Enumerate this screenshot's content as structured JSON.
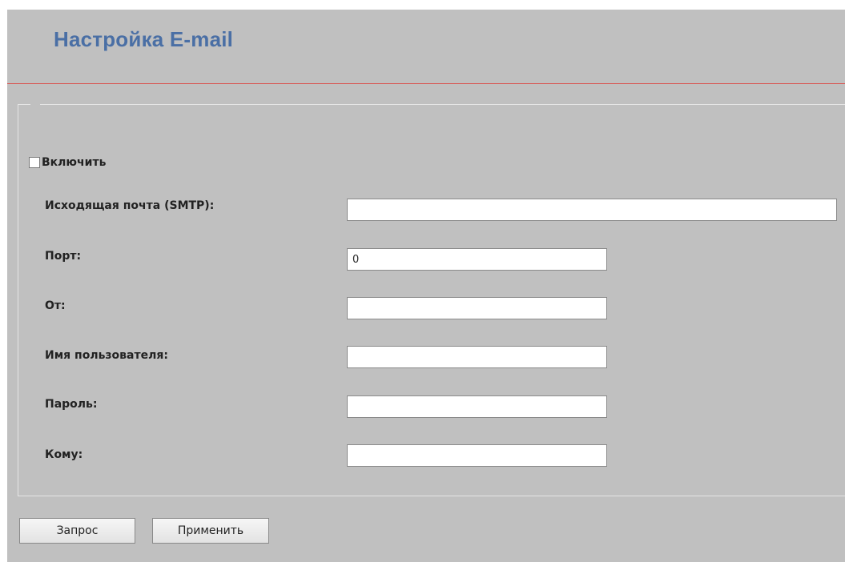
{
  "header": {
    "title": "Настройка E-mail"
  },
  "form": {
    "enable_label": "Включить",
    "enable_checked": false,
    "fields": [
      {
        "label": "Исходящая почта (SMTP):",
        "value": ""
      },
      {
        "label": "Порт:",
        "value": "0"
      },
      {
        "label": "От:",
        "value": ""
      },
      {
        "label": "Имя пользователя:",
        "value": ""
      },
      {
        "label": "Пароль:",
        "value": ""
      },
      {
        "label": "Кому:",
        "value": ""
      }
    ]
  },
  "buttons": {
    "query_label": "Запрос",
    "apply_label": "Применить"
  },
  "colors": {
    "title": "#4a6fa5",
    "divider": "#d9534f",
    "background": "#c0c0c0"
  }
}
